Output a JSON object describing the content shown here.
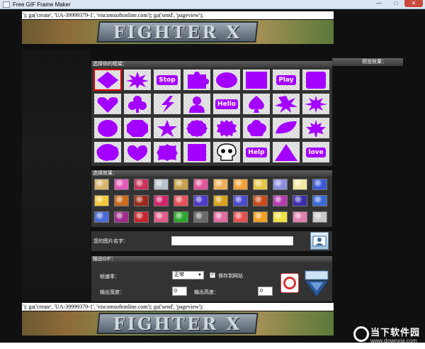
{
  "window": {
    "title": "Free GIF Frame Maker",
    "min": "—",
    "max": "□",
    "close": "✕"
  },
  "script_text": "'); ga('create', 'UA-39999379-1', 'viscomsoftonline.com'); ga('send', 'pageview');",
  "banner_text": "FIGHTER X",
  "sections": {
    "frames": "选择你的框架：",
    "preview": "预览效果：",
    "effects": "选择效果：",
    "photo_name": "您的图片名字：",
    "output": "输出GIF："
  },
  "frames": [
    [
      "diamond",
      "starburst",
      "Stop",
      "puzzle",
      "ellipse",
      "rectangle",
      "Play",
      "rounded-square"
    ],
    [
      "heart",
      "club",
      "lightning",
      "silhouette",
      "Hello",
      "spade",
      "splash",
      "star8"
    ],
    [
      "circle",
      "octagon",
      "star5",
      "scallop",
      "badge",
      "cloud",
      "leaf",
      "maple"
    ],
    [
      "wavy-circle",
      "heart-wide",
      "blob",
      "square",
      "skull",
      "Help",
      "triangle",
      "love"
    ]
  ],
  "frame_color": "#a400ff",
  "effect_colors": [
    [
      "#d7b56b",
      "#e05ab7",
      "#c9345f",
      "#b8c1cc",
      "#c9a14a",
      "#e2569c",
      "#f0b05a",
      "#f2a13a",
      "#e6c64a",
      "#8e8ee0",
      "#f2e6a0",
      "#3c5ad8"
    ],
    [
      "#f0c83a",
      "#c96a1a",
      "#9c2a1a",
      "#d0246a",
      "#e8505a",
      "#4a3ac8",
      "#d8a21a",
      "#4a4ad0",
      "#c84a1a",
      "#b83ab0",
      "#3c2cb0",
      "#3a6ad8"
    ],
    [
      "#4a6ad8",
      "#a02a8a",
      "#c8242c",
      "#e05a8a",
      "#2aa82a",
      "#6a6a6a",
      "#e06aa0",
      "#e85050",
      "#f0a020",
      "#f0e040",
      "#e080b0",
      "#c8c8c8"
    ]
  ],
  "output": {
    "frame_rate_label": "帧速率：",
    "frame_rate_value": "正常",
    "save_site_label": "保存到网站",
    "width_label": "输出宽度：",
    "width_value": "0",
    "height_label": "输出高度：",
    "height_value": "0"
  },
  "watermark": {
    "name": "当下软件园",
    "url": "www.downxia.com"
  }
}
